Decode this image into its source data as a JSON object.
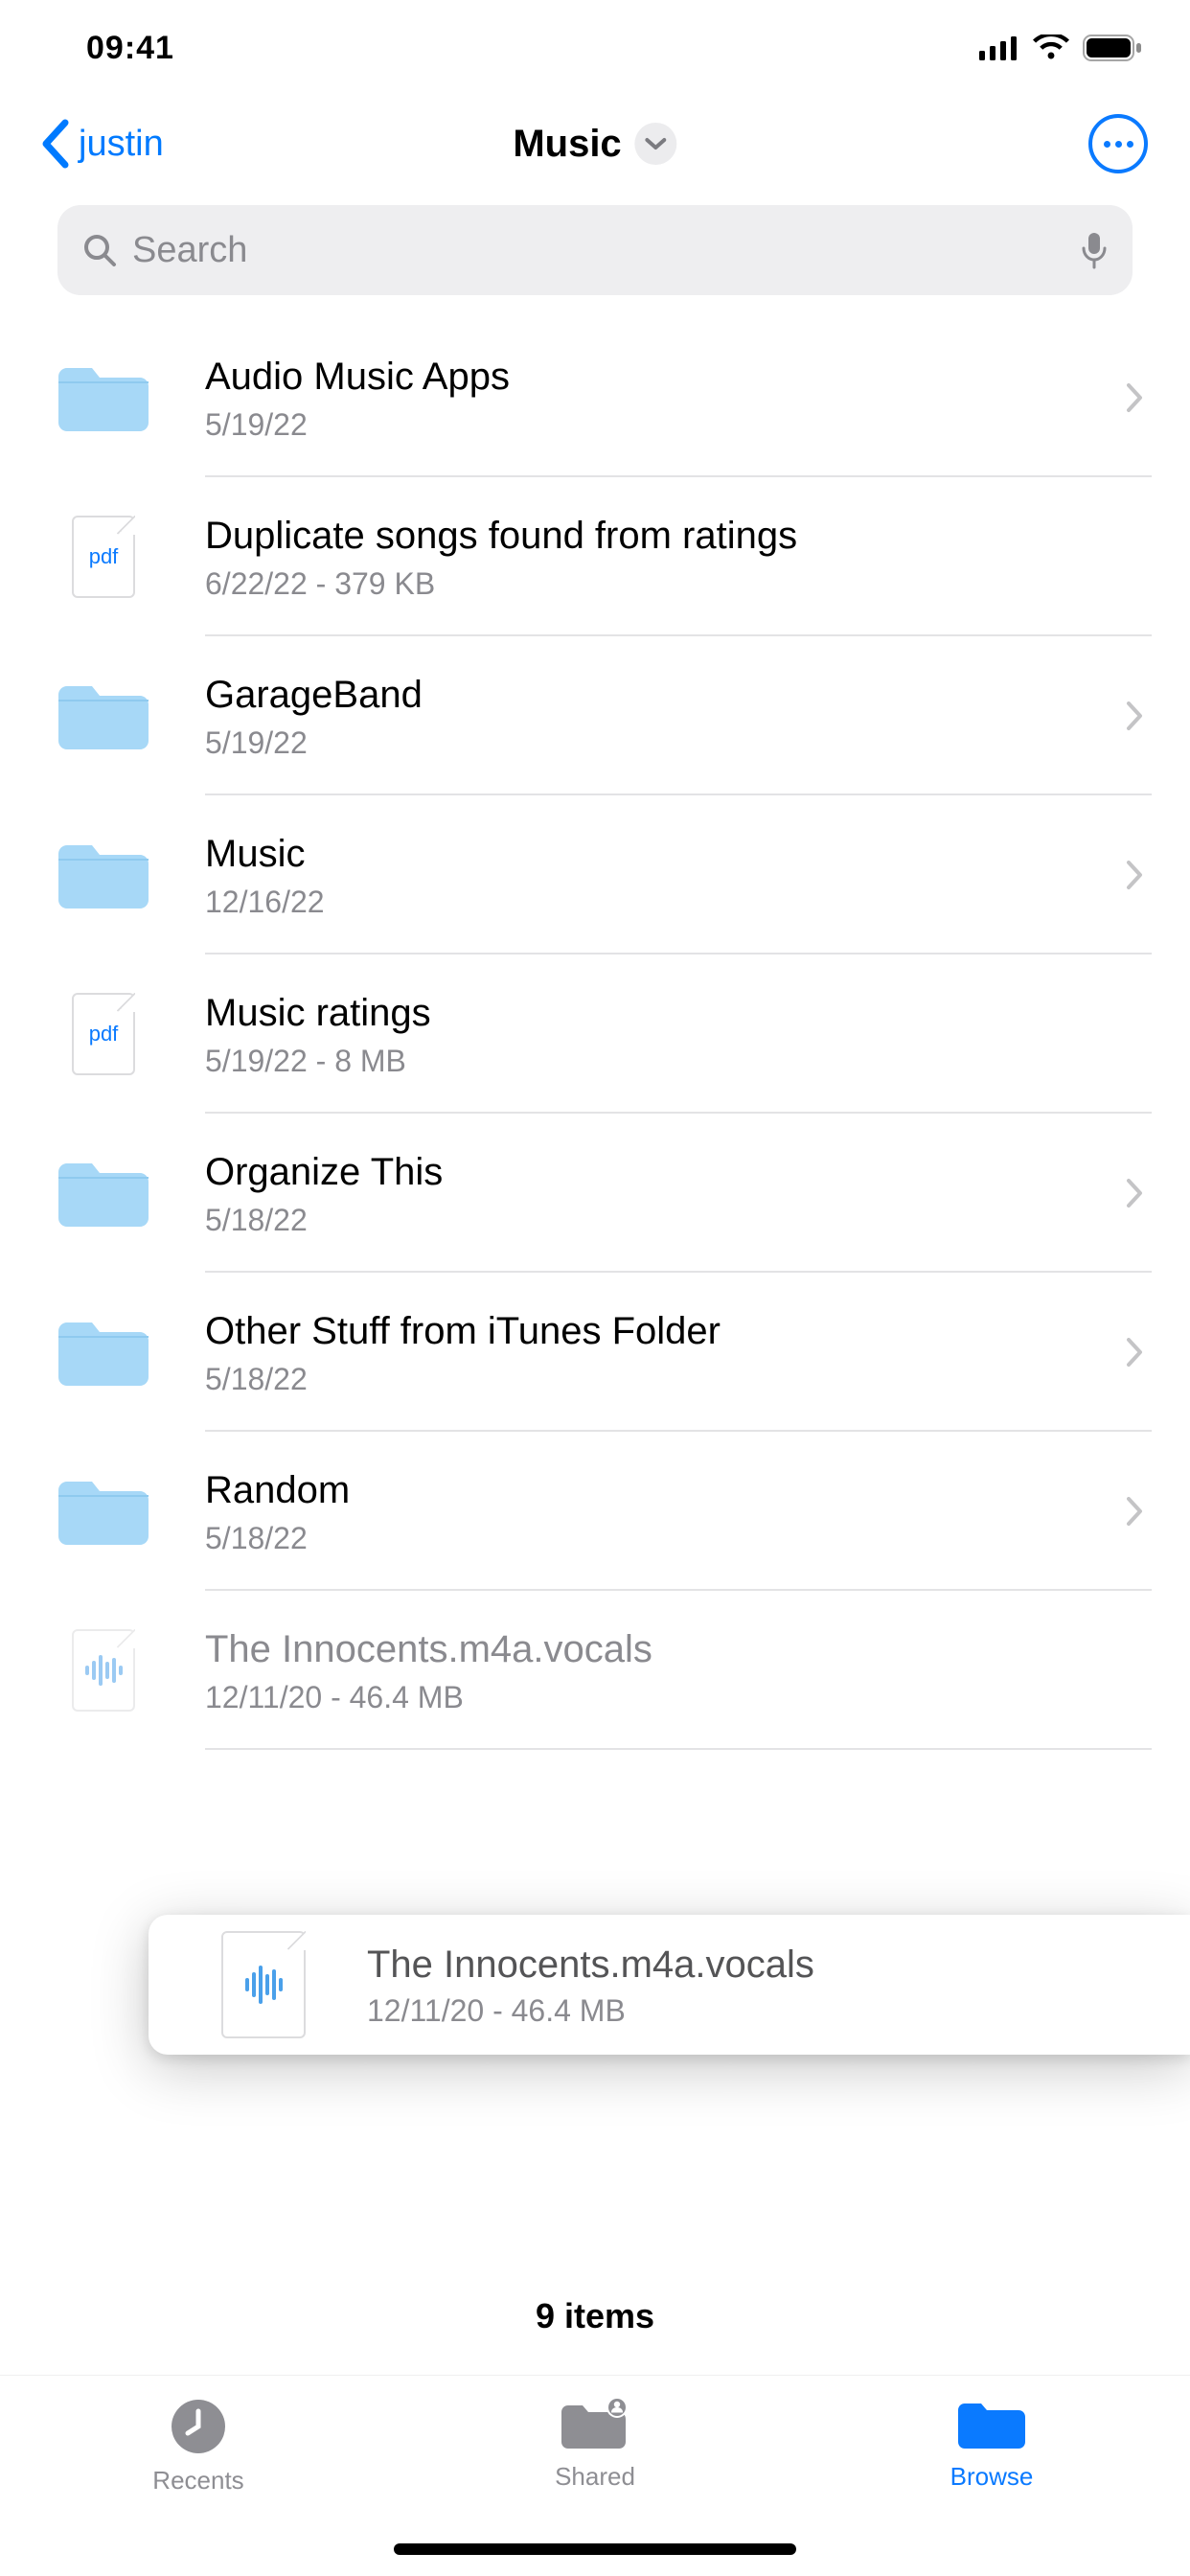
{
  "status": {
    "time": "09:41"
  },
  "nav": {
    "back_label": "justin",
    "title": "Music"
  },
  "search": {
    "placeholder": "Search"
  },
  "items": [
    {
      "type": "folder",
      "title": "Audio Music Apps",
      "sub": "5/19/22",
      "chevron": true
    },
    {
      "type": "pdf",
      "title": "Duplicate songs found from ratings",
      "sub": "6/22/22 - 379 KB",
      "chevron": false
    },
    {
      "type": "folder",
      "title": "GarageBand",
      "sub": "5/19/22",
      "chevron": true
    },
    {
      "type": "folder",
      "title": "Music",
      "sub": "12/16/22",
      "chevron": true
    },
    {
      "type": "pdf",
      "title": "Music ratings",
      "sub": "5/19/22 - 8 MB",
      "chevron": false
    },
    {
      "type": "folder",
      "title": "Organize This",
      "sub": "5/18/22",
      "chevron": true
    },
    {
      "type": "folder",
      "title": "Other Stuff from iTunes Folder",
      "sub": "5/18/22",
      "chevron": true
    },
    {
      "type": "folder",
      "title": "Random",
      "sub": "5/18/22",
      "chevron": true
    },
    {
      "type": "audio",
      "title": "The Innocents.m4a.vocals",
      "sub": "12/11/20 - 46.4 MB",
      "chevron": false,
      "ghost": true
    }
  ],
  "drag": {
    "title": "The Innocents.m4a.vocals",
    "sub": "12/11/20 - 46.4 MB"
  },
  "footer": {
    "count_label": "9 items"
  },
  "tabs": {
    "recents": "Recents",
    "shared": "Shared",
    "browse": "Browse"
  },
  "pdf_label": "pdf"
}
